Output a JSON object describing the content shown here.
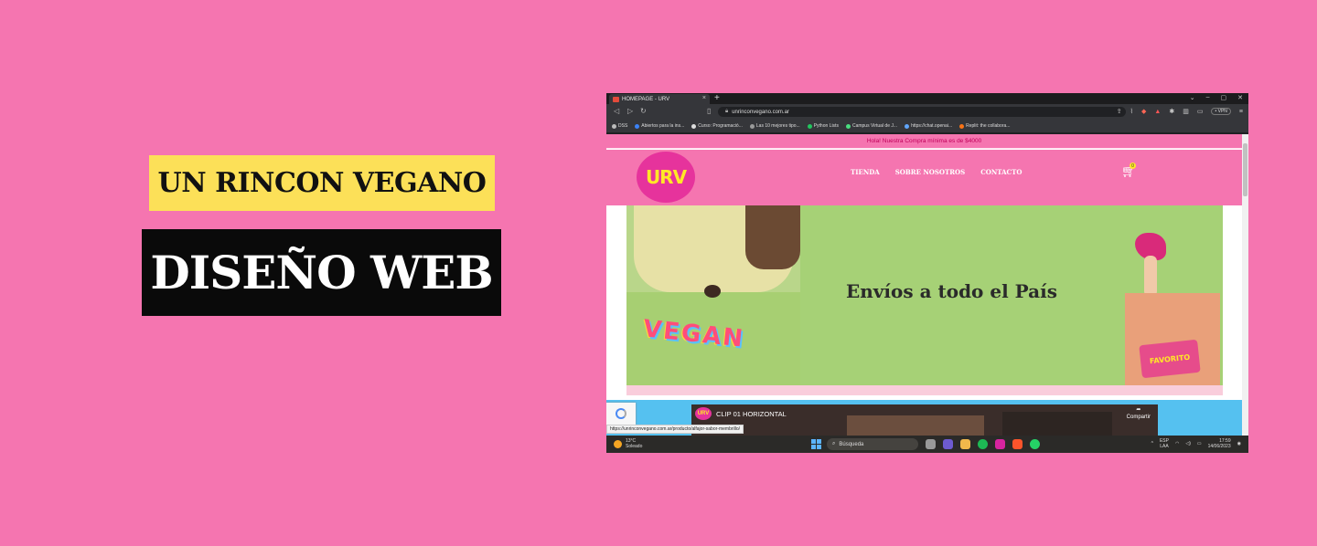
{
  "banner": {
    "title_top": "UN RINCON VEGANO",
    "title_bottom": "DISEÑO WEB"
  },
  "browser": {
    "tab_title": "HOMEPAGE - URV",
    "tab_close": "×",
    "new_tab": "+",
    "url": "unrinconvegano.com.ar",
    "vpn_label": "• VPN",
    "bookmarks": [
      "DSS",
      "Abiertos para la ins...",
      "Curso: Programació...",
      "Las 10 mejores tipo...",
      "Python Lists",
      "Campus Virtual de J...",
      "https://chat.openai...",
      "Replit: the collabora..."
    ],
    "status_url": "https://unrinconvegano.com.ar/producto/alfajor-sabor-membrillo/"
  },
  "site": {
    "notice": "Hola! Nuestra Compra mínima es de $4000",
    "logo": "URV",
    "nav": [
      "TIENDA",
      "SOBRE NOSOTROS",
      "CONTACTO"
    ],
    "cart_count": "0",
    "hero_title": "Envíos a todo el País",
    "hero_letters": "VEGAN",
    "box_label": "FAVORITO",
    "video_logo": "URV",
    "video_title": "CLIP 01 HORIZONTAL",
    "video_share": "Compartir"
  },
  "taskbar": {
    "temp": "13°C",
    "weather": "Soleado",
    "search": "Búsqueda",
    "lang1": "ESP",
    "lang2": "LAA",
    "time": "17:59",
    "date": "14/06/2023"
  },
  "colors": {
    "background": "#f575b0",
    "yellow": "#fce058",
    "black": "#0a0a0a"
  }
}
